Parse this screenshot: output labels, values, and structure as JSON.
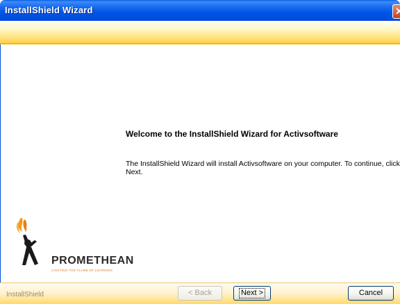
{
  "window": {
    "title": "InstallShield Wizard"
  },
  "content": {
    "heading": "Welcome to the InstallShield Wizard for Activsoftware",
    "body": "The InstallShield Wizard will install Activsoftware on your computer.  To continue, click Next."
  },
  "logo": {
    "name": "PROMETHEAN",
    "tagline": "LIGHTING THE FLAME OF LEARNING"
  },
  "footer": {
    "brand": "InstallShield",
    "back_label": "< Back",
    "next_label": "Next >",
    "cancel_label": "Cancel"
  },
  "colors": {
    "titlebar": "#0055e6",
    "banner": "#ffd24a",
    "flame": "#f39c12"
  }
}
